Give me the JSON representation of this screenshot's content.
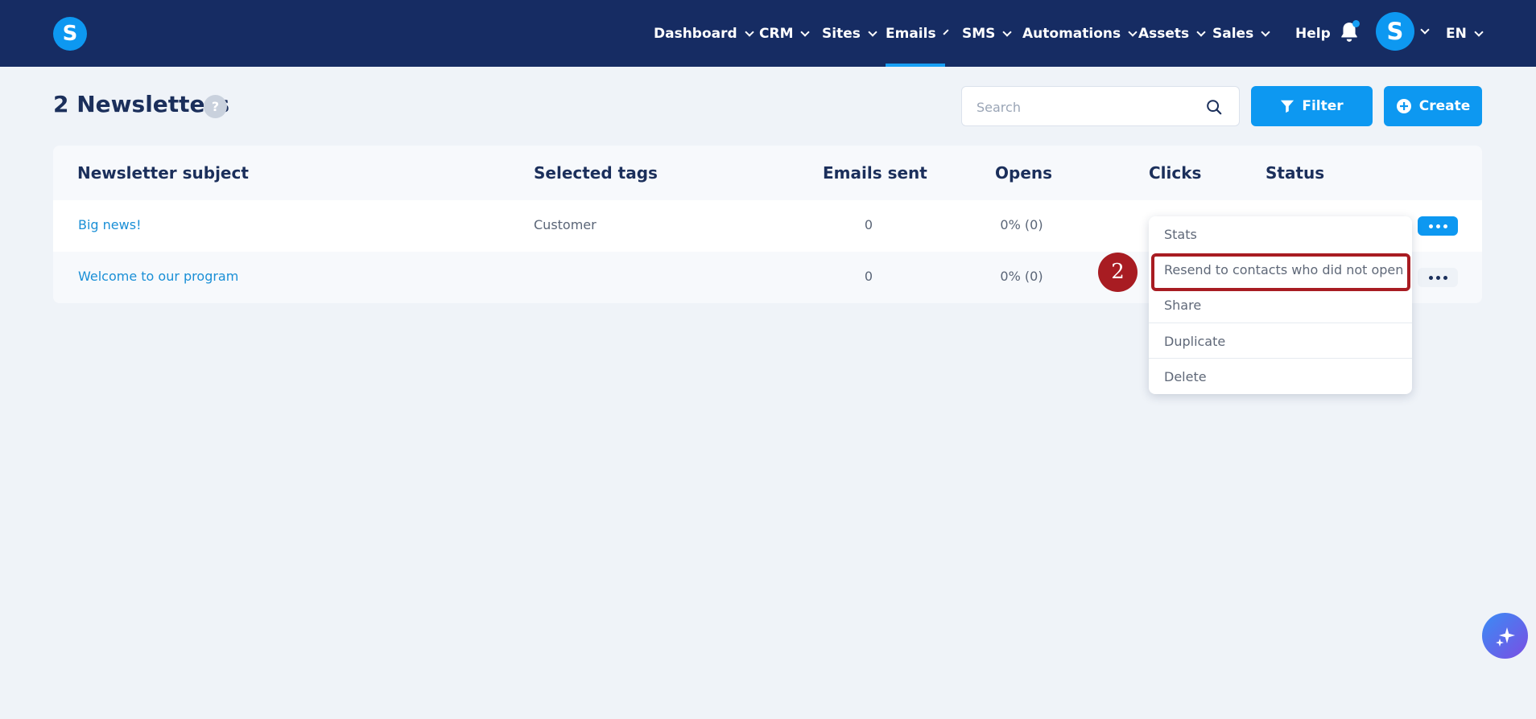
{
  "brand": {
    "logo_letter": "S"
  },
  "nav": {
    "items": [
      {
        "label": "Dashboard"
      },
      {
        "label": "CRM"
      },
      {
        "label": "Sites"
      },
      {
        "label": "Emails"
      },
      {
        "label": "SMS"
      },
      {
        "label": "Automations"
      },
      {
        "label": "Assets"
      },
      {
        "label": "Sales"
      }
    ],
    "active": "Emails",
    "help_label": "Help",
    "avatar_letter": "S",
    "language": "EN"
  },
  "page": {
    "title": "2 Newsletters",
    "help_badge": "?"
  },
  "toolbar": {
    "search_placeholder": "Search",
    "filter_label": "Filter",
    "create_label": "Create"
  },
  "table": {
    "headers": [
      "Newsletter subject",
      "Selected tags",
      "Emails sent",
      "Opens",
      "Clicks",
      "Status"
    ],
    "rows": [
      {
        "subject": "Big news!",
        "tags": "Customer",
        "emails_sent": "0",
        "opens": "0% (0)"
      },
      {
        "subject": "Welcome to our program",
        "tags": "",
        "emails_sent": "0",
        "opens": "0% (0)"
      }
    ]
  },
  "row_menu": {
    "items": [
      "Stats",
      "Resend to contacts who did not open",
      "Share",
      "Duplicate",
      "Delete"
    ],
    "highlighted": "Resend to contacts who did not open"
  },
  "annotation": {
    "step": "2"
  },
  "colors": {
    "navbar": "#162c63",
    "accent": "#0d98f1",
    "link": "#1a8fd6",
    "annotation": "#a81c22",
    "background": "#eff3f8"
  }
}
